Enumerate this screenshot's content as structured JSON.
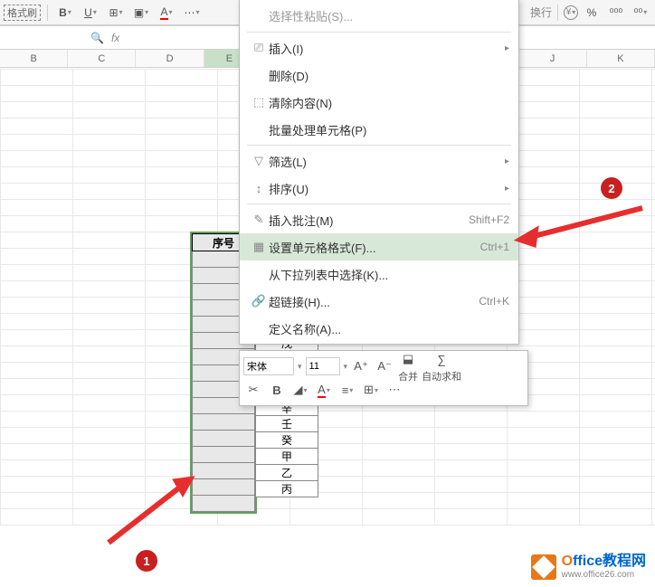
{
  "toolbar": {
    "format_painter": "格式刷",
    "wrap_text": "换行"
  },
  "formula_bar": {
    "fx": "fx"
  },
  "columns": [
    "B",
    "C",
    "D",
    "E",
    "",
    "",
    "",
    "",
    "",
    "J",
    "K"
  ],
  "context_menu": {
    "paste_special": "选择性粘贴(S)...",
    "insert": "插入(I)",
    "delete": "删除(D)",
    "clear": "清除内容(N)",
    "batch": "批量处理单元格(P)",
    "filter": "筛选(L)",
    "sort": "排序(U)",
    "comment": "插入批注(M)",
    "comment_shortcut": "Shift+F2",
    "format_cells": "设置单元格格式(F)...",
    "format_shortcut": "Ctrl+1",
    "dropdown": "从下拉列表中选择(K)...",
    "hyperlink": "超链接(H)...",
    "hyperlink_shortcut": "Ctrl+K",
    "define_name": "定义名称(A)..."
  },
  "mini_toolbar": {
    "font": "宋体",
    "size": "11",
    "merge": "合并",
    "autosum": "自动求和"
  },
  "sheet": {
    "header1": "序号",
    "values": [
      "戊",
      "",
      "",
      "辛",
      "壬",
      "癸",
      "甲",
      "乙",
      "丙"
    ]
  },
  "markers": {
    "one": "1",
    "two": "2"
  },
  "watermark": {
    "brand_o": "O",
    "brand_rest": "ffice教程网",
    "url": "www.office26.com"
  }
}
